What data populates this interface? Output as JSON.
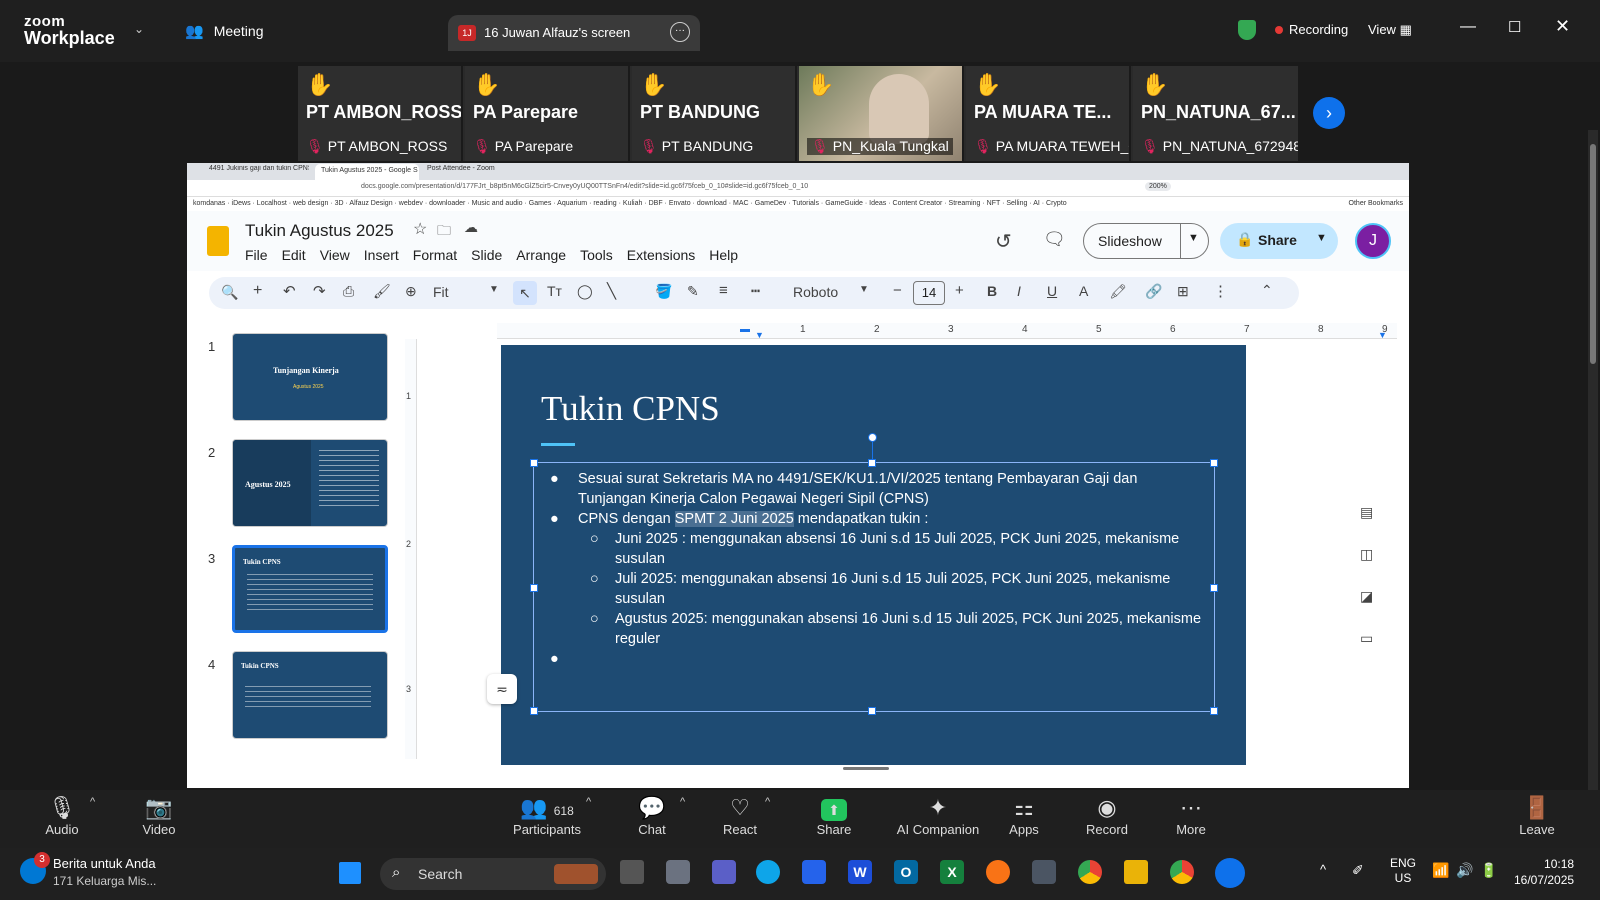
{
  "zoom": {
    "brand_line1": "zoom",
    "brand_line2": "Workplace",
    "meeting_label": "Meeting",
    "share_tab": "16 Juwan Alfauz's screen",
    "share_badge": "1J",
    "recording": "Recording",
    "view": "View"
  },
  "participants": [
    {
      "big": "PT AMBON_ROSS",
      "name": "PT AMBON_ROSS"
    },
    {
      "big": "PA Parepare",
      "name": "PA Parepare"
    },
    {
      "big": "PT BANDUNG",
      "name": "PT BANDUNG"
    },
    {
      "big": "",
      "name": "PN_Kuala Tungkal"
    },
    {
      "big": "PA MUARA TE...",
      "name": "PA MUARA TEWEH_Op..."
    },
    {
      "big": "PN_NATUNA_67...",
      "name": "PN_NATUNA_672948"
    }
  ],
  "browser": {
    "tab1": "4491 Jukinis gaji dan tukin CPNS bu",
    "tab2": "Tukin Agustus 2025 - Google S",
    "tab3": "Post Attendee - Zoom",
    "url": "docs.google.com/presentation/d/177FJrt_b8pt5nM6cGlZ5cir5-Cnvey0yUQ00TTSnFn4/edit?slide=id.gc6f75fceb_0_10#slide=id.gc6f75fceb_0_10",
    "zoom_level": "200%",
    "bookmarks": "komdanas · iDews · Localhost · web design · 3D · Alfauz Design · webdev · downloader · Music and audio · Games · Aquarium · reading · Kuliah · DBF · Envato · download · MAC · GameDev · Tutorials · GameGuide · Ideas · Content Creator · Streaming · NFT · Selling · AI · Crypto",
    "other_bookmarks": "Other Bookmarks"
  },
  "slides_app": {
    "doc_title": "Tukin Agustus 2025",
    "menu": [
      "File",
      "Edit",
      "View",
      "Insert",
      "Format",
      "Slide",
      "Arrange",
      "Tools",
      "Extensions",
      "Help"
    ],
    "slideshow": "Slideshow",
    "share": "Share",
    "avatar": "J",
    "zoom_fit": "Fit",
    "font": "Roboto",
    "font_size": "14",
    "ruler": [
      "1",
      "2",
      "3",
      "4",
      "5",
      "6",
      "7",
      "8",
      "9"
    ],
    "vruler": [
      "1",
      "2",
      "3"
    ]
  },
  "thumbnails": [
    {
      "num": "1",
      "title": "Tunjangan Kinerja",
      "sub": "Agustus 2025"
    },
    {
      "num": "2",
      "title": "Agustus 2025"
    },
    {
      "num": "3",
      "title": "Tukin CPNS"
    },
    {
      "num": "4",
      "title": "Tukin CPNS"
    }
  ],
  "slide": {
    "title": "Tukin CPNS",
    "bullet1": "Sesuai surat Sekretaris MA no 4491/SEK/KU1.1/VI/2025 tentang Pembayaran Gaji dan Tunjangan Kinerja Calon Pegawai Negeri Sipil (CPNS)",
    "bullet2_pre": "CPNS dengan ",
    "bullet2_hl": "SPMT 2 Juni 2025",
    "bullet2_post": " mendapatkan tukin :",
    "sub1": "Juni 2025 : menggunakan absensi 16 Juni s.d 15 Juli 2025, PCK Juni 2025, mekanisme susulan",
    "sub2": "Juli 2025: menggunakan absensi 16 Juni s.d 15 Juli 2025, PCK Juni 2025, mekanisme susulan",
    "sub3": "Agustus 2025: menggunakan absensi 16 Juni s.d 15 Juli 2025, PCK Juni 2025, mekanisme reguler"
  },
  "bottom_bar": {
    "audio": "Audio",
    "video": "Video",
    "participants": "Participants",
    "participants_count": "618",
    "chat": "Chat",
    "react": "React",
    "share": "Share",
    "ai": "AI Companion",
    "apps": "Apps",
    "record": "Record",
    "more": "More",
    "leave": "Leave"
  },
  "taskbar": {
    "news_title": "Berita untuk Anda",
    "news_sub": "171 Keluarga Mis...",
    "news_badge": "3",
    "search": "Search",
    "lang1": "ENG",
    "lang2": "US",
    "time": "10:18",
    "date": "16/07/2025"
  },
  "colors": {
    "slide_bg": "#1e4b73",
    "accent": "#4fc3f7",
    "zoom_dark": "#1f1f1f",
    "selection_blue": "#1a73e8",
    "share_btn": "#c2e7ff"
  }
}
